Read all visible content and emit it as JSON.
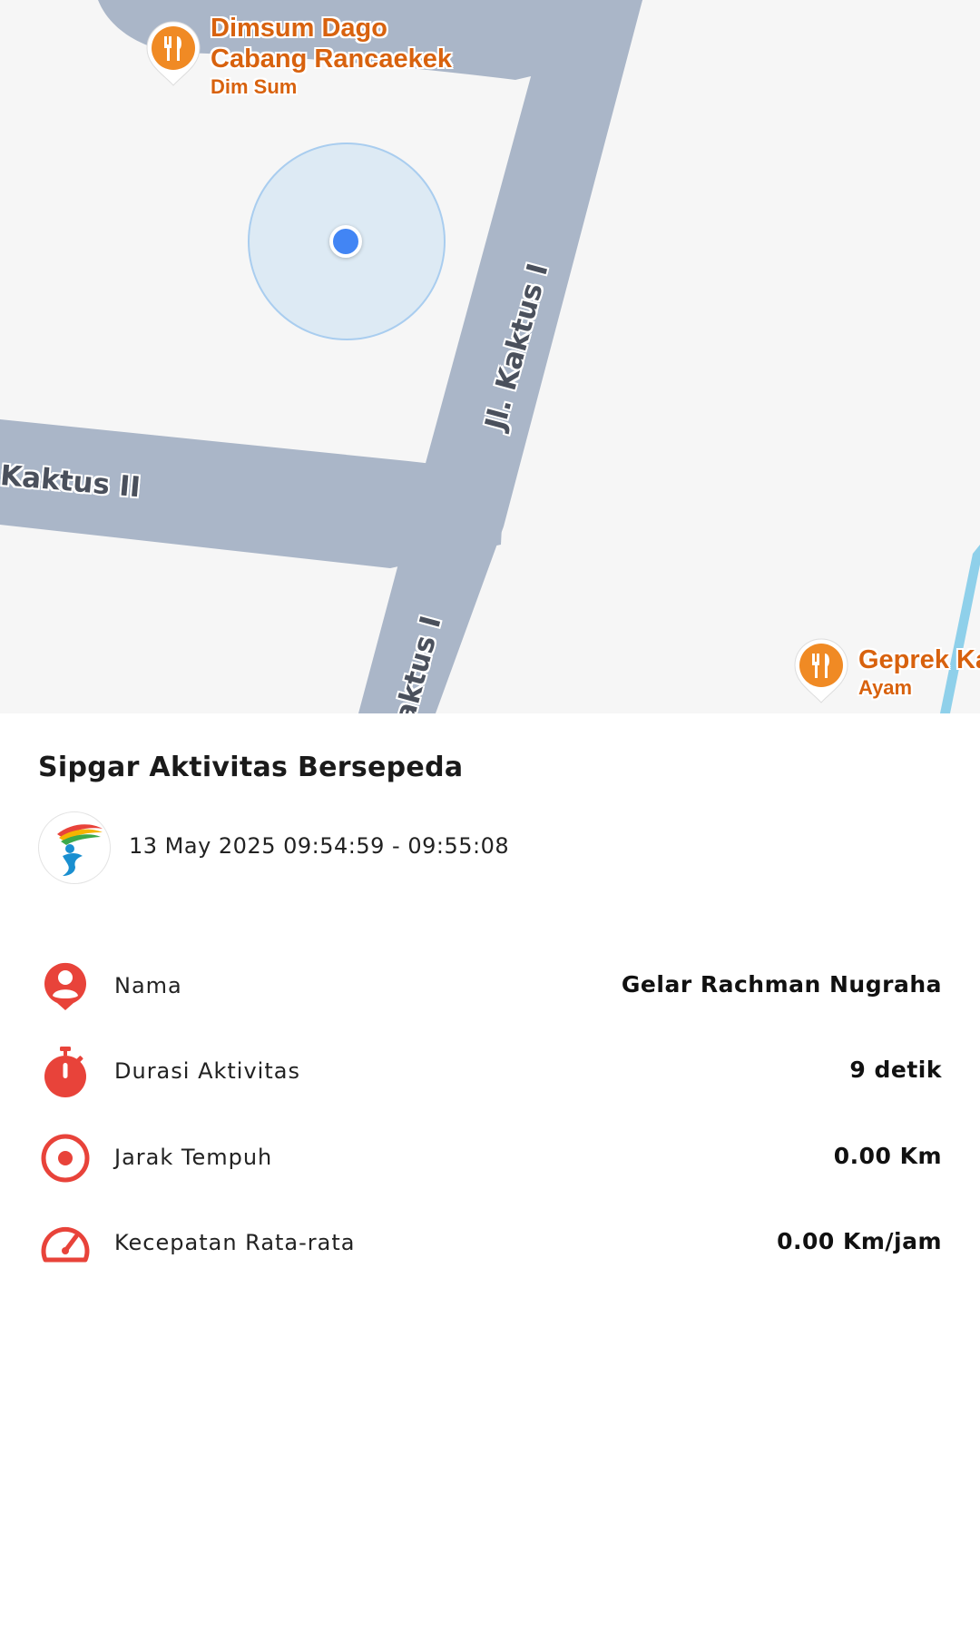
{
  "map": {
    "road_labels": [
      "Jl. Kaktus I",
      "Kaktus II",
      "aktus I"
    ],
    "pois": [
      {
        "name_line1": "Dimsum Dago",
        "name_line2": "Cabang Rancaekek",
        "category": "Dim Sum",
        "icon": "restaurant-icon"
      },
      {
        "name_line1": "Geprek Ka",
        "category": "Ayam",
        "icon": "restaurant-icon"
      }
    ],
    "colors": {
      "road": "#aab6c8",
      "poi": "#d8620e",
      "location": "#4285f4",
      "water": "#8fd0ea"
    }
  },
  "activity": {
    "title": "Sipgar Aktivitas Bersepeda",
    "datetime": "13 May 2025 09:54:59 - 09:55:08",
    "logo_icon": "sipgar-logo"
  },
  "stats": [
    {
      "label": "Nama",
      "value": "Gelar Rachman Nugraha",
      "icon": "person-pin-icon"
    },
    {
      "label": "Durasi Aktivitas",
      "value": "9 detik",
      "icon": "stopwatch-icon"
    },
    {
      "label": "Jarak Tempuh",
      "value": "0.00 Km",
      "icon": "target-icon"
    },
    {
      "label": "Kecepatan Rata-rata",
      "value": "0.00 Km/jam",
      "icon": "speedometer-icon"
    }
  ],
  "accent_color": "#e8433a"
}
